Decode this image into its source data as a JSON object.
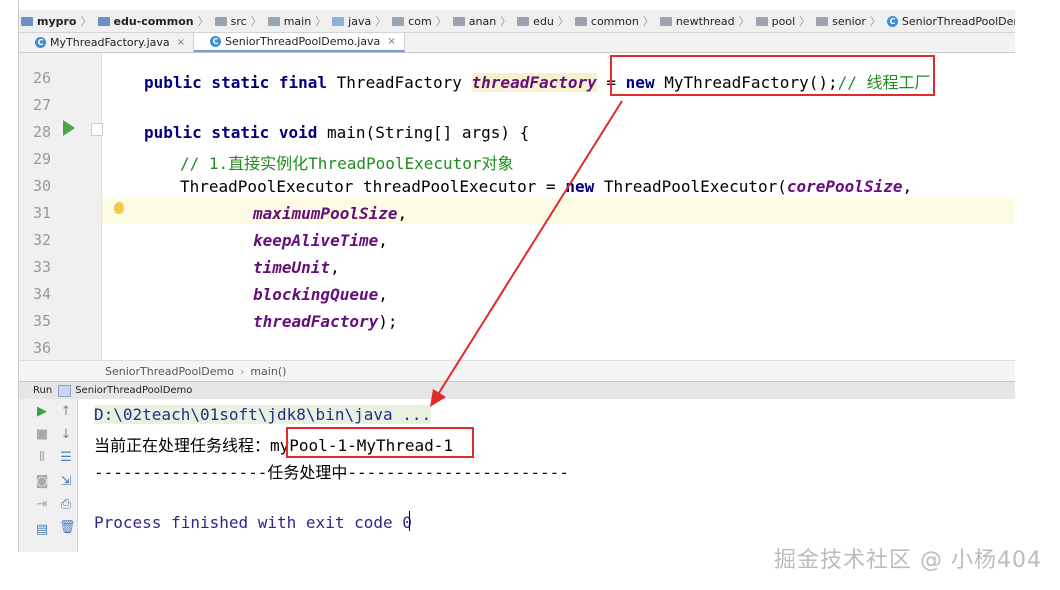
{
  "breadcrumb": [
    "mypro",
    "edu-common",
    "src",
    "main",
    "java",
    "com",
    "anan",
    "edu",
    "common",
    "newthread",
    "pool",
    "senior",
    "SeniorThreadPoolDemo.java"
  ],
  "tabs": [
    {
      "label": "MyThreadFactory.java",
      "close": "×"
    },
    {
      "label": "SeniorThreadPoolDemo.java",
      "close": "×"
    }
  ],
  "editor": {
    "lines": [
      {
        "num": "26"
      },
      {
        "num": "27"
      },
      {
        "num": "28"
      },
      {
        "num": "29"
      },
      {
        "num": "30"
      },
      {
        "num": "31"
      },
      {
        "num": "32"
      },
      {
        "num": "33"
      },
      {
        "num": "34"
      },
      {
        "num": "35"
      },
      {
        "num": "36"
      }
    ],
    "code": {
      "l26_kw": "public static final",
      "l26_type": " ThreadFactory ",
      "l26_field": "threadFactory",
      "l26_eq": " = ",
      "l26_new": "new",
      "l26_rest": " MyThreadFactory();",
      "l26_cmt": "// 线程工厂",
      "l28_kw": "public static void",
      "l28_rest": " main(String[] args) {",
      "l29_cmt": "// 1.直接实例化ThreadPoolExecutor对象",
      "l30_a": "ThreadPoolExecutor threadPoolExecutor = ",
      "l30_new": "new",
      "l30_b": " ThreadPoolExecutor(",
      "l30_field": "corePoolSize",
      "l30_c": ",",
      "l31_field": "maximumPoolSize",
      "l32_field": "keepAliveTime",
      "l33_field": "timeUnit",
      "l34_field": "blockingQueue",
      "l35_field": "threadFactory",
      "comma": ",",
      "l35_end": ");"
    },
    "footer_crumbs": [
      "SeniorThreadPoolDemo",
      "main()"
    ]
  },
  "run": {
    "label": "Run",
    "config": "SeniorThreadPoolDemo",
    "console": {
      "line1": "D:\\02teach\\01soft\\jdk8\\bin\\java ...",
      "line2_prefix": "当前正在处理任务线程：",
      "line2_value": "myPool-1-MyThread-1",
      "line3": "------------------任务处理中-----------------------",
      "line4": "Process finished with exit code 0"
    }
  },
  "watermark": "掘金技术社区 @ 小杨404",
  "colors": {
    "keyword": "#000080",
    "field": "#660e7a",
    "comment": "#1e8c1e",
    "annotation": "#e02b2b"
  }
}
